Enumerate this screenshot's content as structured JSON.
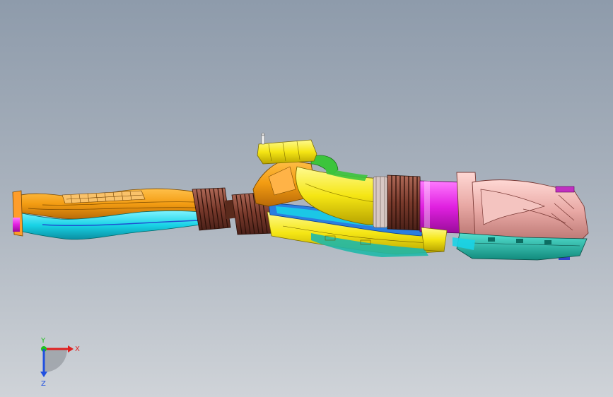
{
  "viewport": {
    "background_top": "#8e9bab",
    "background_bottom": "#cfd3d8"
  },
  "model": {
    "part_colors": {
      "orange": "#f39c12",
      "cyan": "#19d3e6",
      "brown": "#8a4a3a",
      "yellow": "#f5e614",
      "blue": "#2a7ee0",
      "green": "#3cc43c",
      "magenta": "#e020e0",
      "pink": "#e8a8a4",
      "teal": "#1fb8a8",
      "purple": "#c030c0"
    }
  },
  "triad": {
    "x_label": "X",
    "y_label": "Y",
    "z_label": "Z",
    "x_color": "#e02020",
    "y_color": "#20c020",
    "z_color": "#2050e0"
  }
}
